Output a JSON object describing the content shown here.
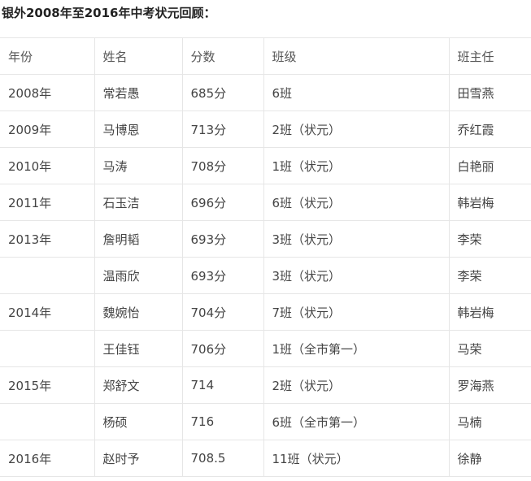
{
  "heading": "银外2008年至2016年中考状元回顾：",
  "table": {
    "headers": [
      "年份",
      "姓名",
      "分数",
      "班级",
      "班主任"
    ],
    "rows": [
      [
        "2008年",
        "常若愚",
        "685分",
        "6班",
        "田雪燕"
      ],
      [
        "2009年",
        "马博恩",
        "713分",
        "2班（状元）",
        "乔红霞"
      ],
      [
        "2010年",
        "马涛",
        "708分",
        "1班（状元）",
        "白艳丽"
      ],
      [
        "2011年",
        "石玉洁",
        "696分",
        "6班（状元）",
        "韩岩梅"
      ],
      [
        "2013年",
        "詹明韬",
        "693分",
        "3班（状元）",
        "李荣"
      ],
      [
        "",
        "温雨欣",
        "693分",
        "3班（状元）",
        "李荣"
      ],
      [
        "2014年",
        "魏婉怡",
        "704分",
        "7班（状元）",
        "韩岩梅"
      ],
      [
        "",
        "王佳钰",
        "706分",
        "1班（全市第一）",
        "马荣"
      ],
      [
        "2015年",
        "郑舒文",
        "714",
        "2班（状元）",
        "罗海燕"
      ],
      [
        "",
        "杨硕",
        "716",
        "6班（全市第一）",
        "马楠"
      ],
      [
        "2016年",
        "赵时予",
        "708.5",
        "11班（状元）",
        "徐静"
      ]
    ]
  }
}
